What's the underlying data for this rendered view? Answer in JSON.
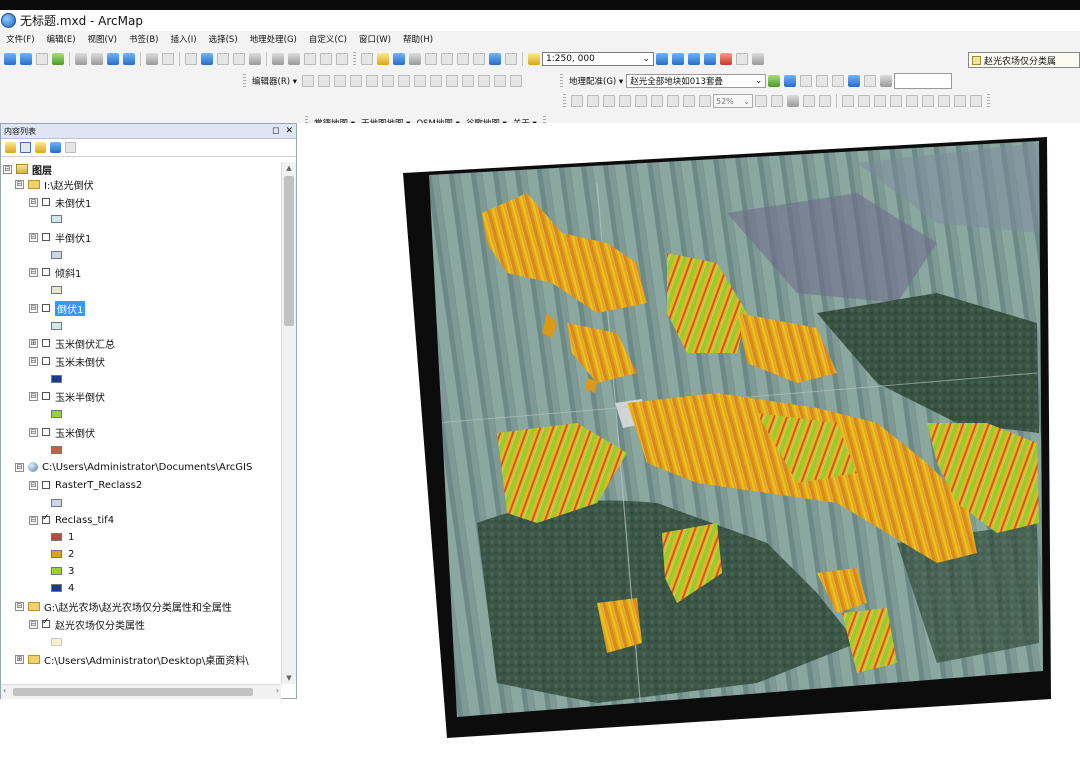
{
  "window": {
    "title": "无标题.mxd - ArcMap"
  },
  "menu": [
    "文件(F)",
    "编辑(E)",
    "视图(V)",
    "书签(B)",
    "插入(I)",
    "选择(S)",
    "地理处理(G)",
    "自定义(C)",
    "窗口(W)",
    "帮助(H)"
  ],
  "toolbar": {
    "scale": "1:250, 000",
    "editor_label": "编辑器(R) ▾",
    "georef_label": "地理配准(G) ▾",
    "georef_layer": "赵光全部地块如013套叠",
    "layer_dropdown": "赵光农场仅分类属",
    "zoom_value": "52%",
    "basemaps": [
      "常德地图 ▾",
      "天地图地图 ▾",
      "OSM地图 ▾",
      "谷歌地图 ▾",
      "关于 ▾"
    ]
  },
  "toc": {
    "title": "内容列表",
    "root": "图层",
    "items": [
      {
        "kind": "group",
        "expander": "⊟",
        "label": "I:\\赵光倒伏"
      },
      {
        "kind": "layer",
        "expander": "⊟",
        "checked": false,
        "label": "未倒伏1",
        "swatch": "#cfe8ec"
      },
      {
        "kind": "layer",
        "expander": "⊟",
        "checked": false,
        "label": "半倒伏1",
        "swatch": "#cfd6e6"
      },
      {
        "kind": "layer",
        "expander": "⊟",
        "checked": false,
        "label": "倾斜1",
        "swatch": "#e6e6cc"
      },
      {
        "kind": "layer",
        "expander": "⊟",
        "checked": false,
        "label": "倒伏1",
        "selected": true,
        "swatch": "#cfeaea"
      },
      {
        "kind": "layer",
        "expander": "⊞",
        "checked": false,
        "label": "玉米倒伏汇总"
      },
      {
        "kind": "layer",
        "expander": "⊟",
        "checked": false,
        "label": "玉米未倒伏",
        "swatch": "#1a3a8c"
      },
      {
        "kind": "layer",
        "expander": "⊟",
        "checked": false,
        "label": "玉米半倒伏",
        "swatch": "#99d333"
      },
      {
        "kind": "layer",
        "expander": "⊟",
        "checked": false,
        "label": "玉米倒伏",
        "swatch": "#c0643c"
      },
      {
        "kind": "dbgroup",
        "expander": "⊟",
        "label": "C:\\Users\\Administrator\\Documents\\ArcGIS"
      },
      {
        "kind": "layer",
        "expander": "⊟",
        "checked": false,
        "label": "RasterT_Reclass2",
        "swatch": "#cfd6e6"
      },
      {
        "kind": "layer",
        "expander": "⊟",
        "checked": true,
        "label": "Reclass_tif4"
      },
      {
        "kind": "class",
        "label": "1",
        "swatch": "#b0503a"
      },
      {
        "kind": "class",
        "label": "2",
        "swatch": "#d9a520"
      },
      {
        "kind": "class",
        "label": "3",
        "swatch": "#99d333"
      },
      {
        "kind": "class",
        "label": "4",
        "swatch": "#1a3a8c"
      },
      {
        "kind": "group",
        "expander": "⊟",
        "label": "G:\\赵光农场\\赵光农场仅分类属性和全属性"
      },
      {
        "kind": "layer",
        "expander": "⊟",
        "checked": true,
        "label": "赵光农场仅分类属性",
        "swatch": "#f7f0c8"
      },
      {
        "kind": "group",
        "expander": "⊞",
        "label": "C:\\Users\\Administrator\\Desktop\\桌面资料\\"
      }
    ]
  },
  "colors": {
    "class_1": "#b0503a",
    "class_2": "#d9a520",
    "class_3": "#99d333",
    "class_4": "#1a3a8c",
    "selection": "#3399ff",
    "imagery_base": "#6f8c86",
    "forest": "#2f4a3a"
  }
}
